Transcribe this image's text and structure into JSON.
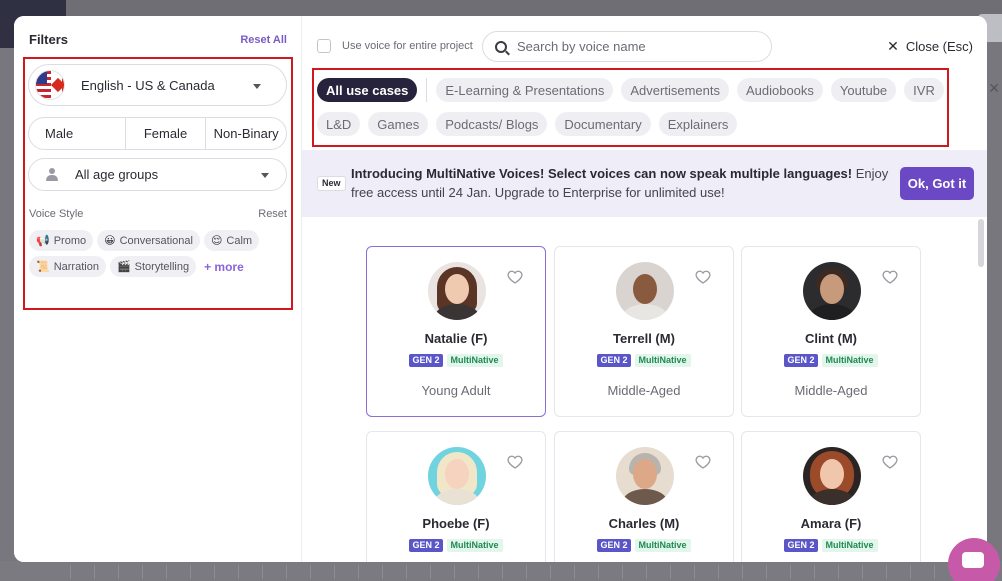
{
  "filters": {
    "title": "Filters",
    "reset_all": "Reset All",
    "language": "English - US & Canada",
    "genders": [
      "Male",
      "Female",
      "Non-Binary"
    ],
    "age_group": "All age groups",
    "voice_style_label": "Voice Style",
    "voice_style_reset": "Reset",
    "styles": [
      {
        "label": "Promo",
        "icon": "megaphone-icon"
      },
      {
        "label": "Conversational",
        "icon": "smile-icon"
      },
      {
        "label": "Calm",
        "icon": "calm-face-icon"
      },
      {
        "label": "Narration",
        "icon": "scroll-icon"
      },
      {
        "label": "Storytelling",
        "icon": "clapperboard-icon"
      }
    ],
    "more": "+ more"
  },
  "topbar": {
    "use_voice_label": "Use voice for entire project",
    "search_placeholder": "Search by voice name",
    "close_label": "Close (Esc)"
  },
  "use_cases": [
    "All use cases",
    "E-Learning & Presentations",
    "Advertisements",
    "Audiobooks",
    "Youtube",
    "IVR",
    "L&D",
    "Games",
    "Podcasts/ Blogs",
    "Documentary",
    "Explainers"
  ],
  "banner": {
    "badge": "New",
    "bold_text": "Introducing MultiNative Voices! Select voices can now speak multiple languages!",
    "text": " Enjoy free access until 24 Jan. Upgrade to Enterprise for unlimited use!",
    "button": "Ok, Got it"
  },
  "voices": [
    {
      "name": "Natalie (F)",
      "gen": "GEN 2",
      "tag": "MultiNative",
      "age": "Young Adult"
    },
    {
      "name": "Terrell (M)",
      "gen": "GEN 2",
      "tag": "MultiNative",
      "age": "Middle-Aged"
    },
    {
      "name": "Clint (M)",
      "gen": "GEN 2",
      "tag": "MultiNative",
      "age": "Middle-Aged"
    },
    {
      "name": "Phoebe (F)",
      "gen": "GEN 2",
      "tag": "MultiNative",
      "age": ""
    },
    {
      "name": "Charles (M)",
      "gen": "GEN 2",
      "tag": "MultiNative",
      "age": ""
    },
    {
      "name": "Amara (F)",
      "gen": "GEN 2",
      "tag": "MultiNative",
      "age": ""
    }
  ],
  "colors": {
    "accent": "#6c49c4",
    "active_chip": "#27233c",
    "highlight_border": "#d0191f"
  }
}
